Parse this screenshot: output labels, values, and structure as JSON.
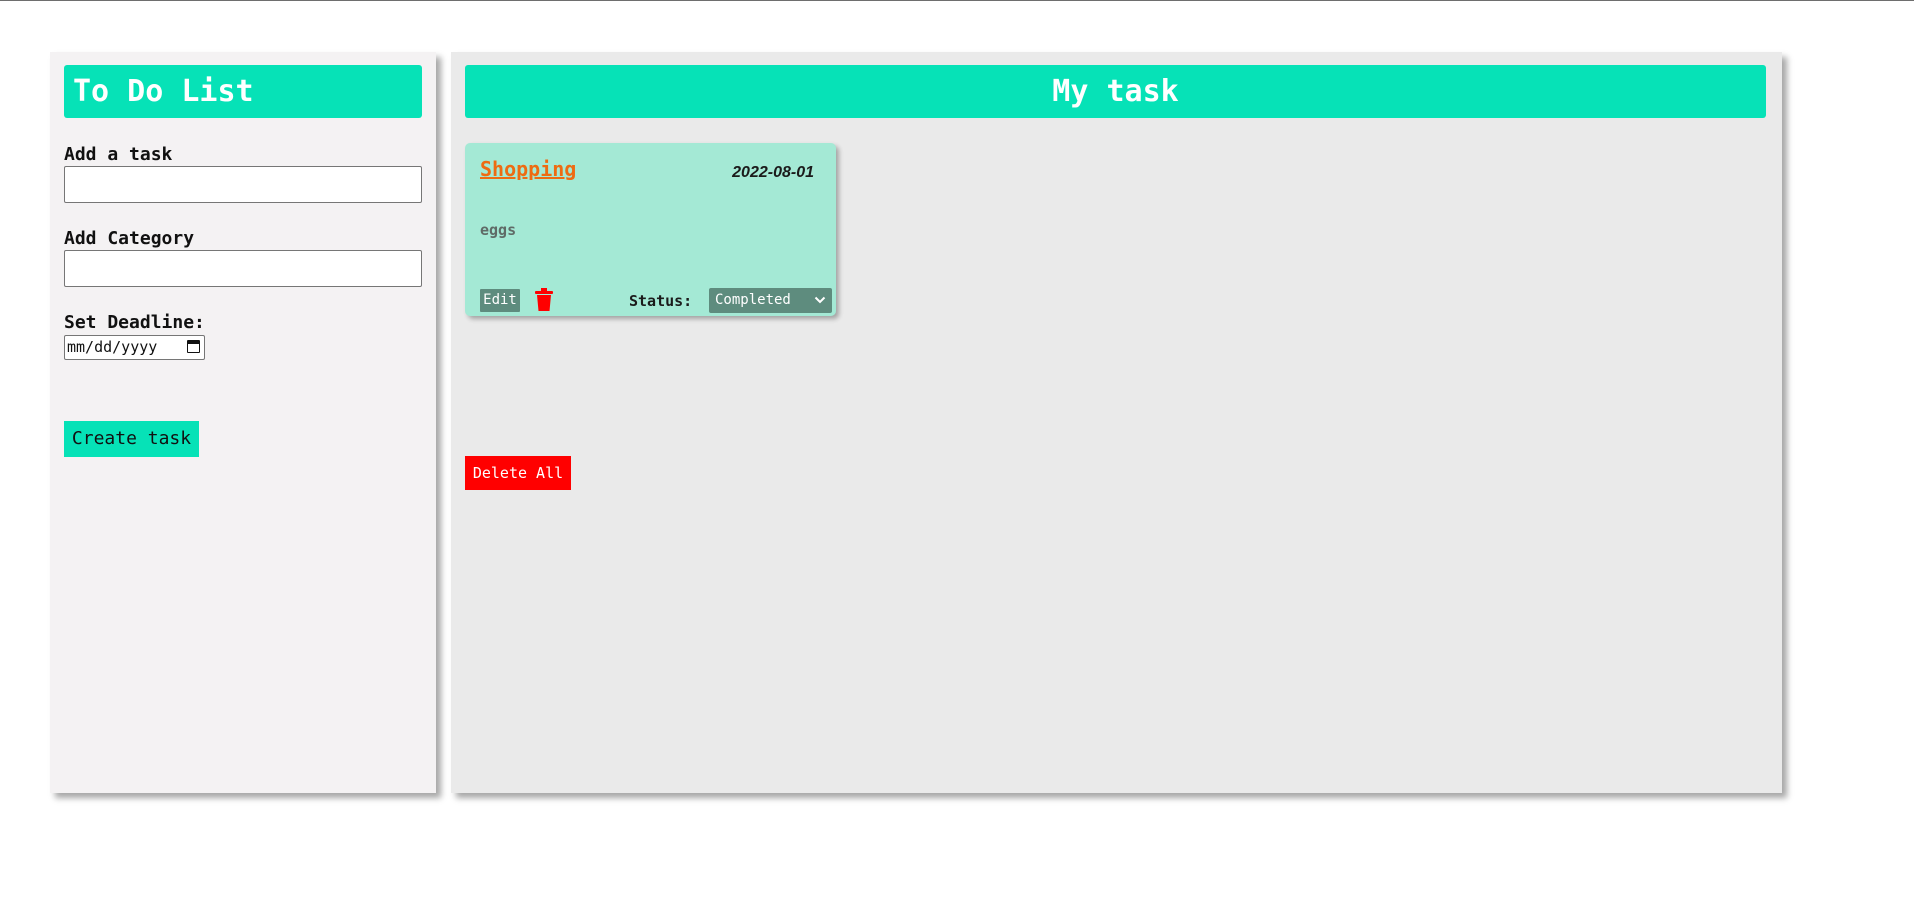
{
  "sidebar": {
    "title": "To Do List",
    "task_label": "Add a task",
    "task_value": "",
    "category_label": "Add Category",
    "category_value": "",
    "deadline_label": "Set Deadline:",
    "deadline_placeholder": "mm/dd/yyyy",
    "create_button": "Create task",
    "accent_color": "#06e2b7"
  },
  "main": {
    "title": "My task",
    "tasks": [
      {
        "title": "Shopping",
        "date": "2022-08-01",
        "description": "eggs",
        "edit_label": "Edit",
        "delete_icon": "trash-icon",
        "status_label": "Status:",
        "status_value": "Completed"
      }
    ],
    "delete_all_button": "Delete All",
    "delete_color": "#ff0000"
  }
}
